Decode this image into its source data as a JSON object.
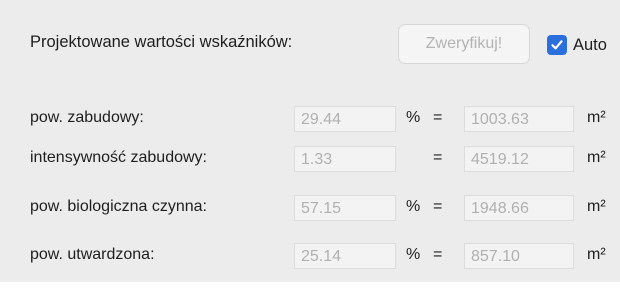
{
  "header": {
    "label": "Projektowane wartości wskaźników:",
    "verify_button": "Zweryfikuj!",
    "auto_label": "Auto",
    "auto_checked": true
  },
  "rows": [
    {
      "label": "pow. zabudowy:",
      "percent_value": "29.44",
      "percent_symbol": "%",
      "equals": "=",
      "value": "1003.63",
      "unit": "m²"
    },
    {
      "label": "intensywność zabudowy:",
      "percent_value": "1.33",
      "percent_symbol": "",
      "equals": "=",
      "value": "4519.12",
      "unit": "m²"
    },
    {
      "label": "pow. biologiczna czynna:",
      "percent_value": "57.15",
      "percent_symbol": "%",
      "equals": "=",
      "value": "1948.66",
      "unit": "m²"
    },
    {
      "label": "pow. utwardzona:",
      "percent_value": "25.14",
      "percent_symbol": "%",
      "equals": "=",
      "value": "857.10",
      "unit": "m²"
    }
  ],
  "colors": {
    "accent": "#2a6fdb",
    "panel_background": "#ececec",
    "disabled_text": "#b0b0b0"
  }
}
